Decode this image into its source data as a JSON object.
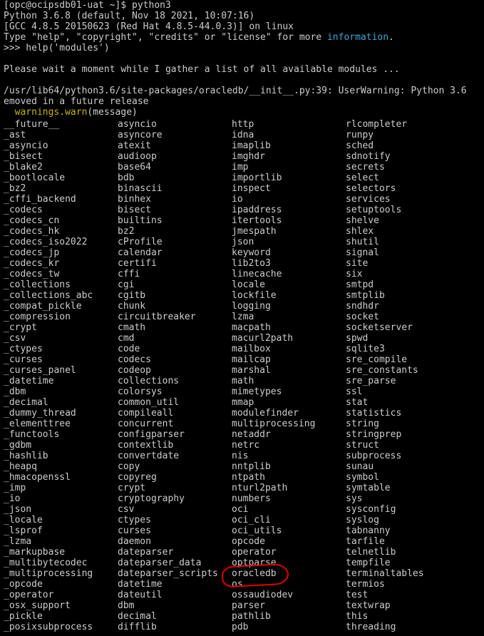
{
  "terminal": {
    "prompt_line": "[opc@ocipsdb01-uat ~]$ python3",
    "banner_1": "Python 3.6.8 (default, Nov 18 2021, 10:07:16)",
    "banner_2": "[GCC 4.8.5 20150623 (Red Hat 4.8.5-44.0.3)] on linux",
    "banner_3_prefix": "Type \"help\", \"copyright\", \"credits\" or \"license\" for more ",
    "banner_3_link": "information",
    "banner_3_suffix": ".",
    "repl_input": ">>> help('modules')",
    "blank": "",
    "wait_message": "Please wait a moment while I gather a list of all available modules ...",
    "warning_1": "/usr/lib64/python3.6/site-packages/oracledb/__init__.py:39: UserWarning: Python 3.6",
    "warning_2": "emoved in a future release",
    "warning_3_indent": "  ",
    "warning_3_fn": "warnings.warn",
    "warning_3_rest": "(message)"
  },
  "colors": {
    "background": "#000000",
    "text": "#cccccc",
    "link": "#3fa6d6",
    "warn_function": "#c8b400",
    "highlight": "#e10000"
  },
  "modules": [
    [
      "__future__",
      "asyncio",
      "http",
      "rlcompleter"
    ],
    [
      "_ast",
      "asyncore",
      "idna",
      "runpy"
    ],
    [
      "_asyncio",
      "atexit",
      "imaplib",
      "sched"
    ],
    [
      "_bisect",
      "audioop",
      "imghdr",
      "sdnotify"
    ],
    [
      "_blake2",
      "base64",
      "imp",
      "secrets"
    ],
    [
      "_bootlocale",
      "bdb",
      "importlib",
      "select"
    ],
    [
      "_bz2",
      "binascii",
      "inspect",
      "selectors"
    ],
    [
      "_cffi_backend",
      "binhex",
      "io",
      "services"
    ],
    [
      "_codecs",
      "bisect",
      "ipaddress",
      "setuptools"
    ],
    [
      "_codecs_cn",
      "builtins",
      "itertools",
      "shelve"
    ],
    [
      "_codecs_hk",
      "bz2",
      "jmespath",
      "shlex"
    ],
    [
      "_codecs_iso2022",
      "cProfile",
      "json",
      "shutil"
    ],
    [
      "_codecs_jp",
      "calendar",
      "keyword",
      "signal"
    ],
    [
      "_codecs_kr",
      "certifi",
      "lib2to3",
      "site"
    ],
    [
      "_codecs_tw",
      "cffi",
      "linecache",
      "six"
    ],
    [
      "_collections",
      "cgi",
      "locale",
      "smtpd"
    ],
    [
      "_collections_abc",
      "cgitb",
      "lockfile",
      "smtplib"
    ],
    [
      "_compat_pickle",
      "chunk",
      "logging",
      "sndhdr"
    ],
    [
      "_compression",
      "circuitbreaker",
      "lzma",
      "socket"
    ],
    [
      "_crypt",
      "cmath",
      "macpath",
      "socketserver"
    ],
    [
      "_csv",
      "cmd",
      "macurl2path",
      "spwd"
    ],
    [
      "_ctypes",
      "code",
      "mailbox",
      "sqlite3"
    ],
    [
      "_curses",
      "codecs",
      "mailcap",
      "sre_compile"
    ],
    [
      "_curses_panel",
      "codeop",
      "marshal",
      "sre_constants"
    ],
    [
      "_datetime",
      "collections",
      "math",
      "sre_parse"
    ],
    [
      "_dbm",
      "colorsys",
      "mimetypes",
      "ssl"
    ],
    [
      "_decimal",
      "common_util",
      "mmap",
      "stat"
    ],
    [
      "_dummy_thread",
      "compileall",
      "modulefinder",
      "statistics"
    ],
    [
      "_elementtree",
      "concurrent",
      "multiprocessing",
      "string"
    ],
    [
      "_functools",
      "configparser",
      "netaddr",
      "stringprep"
    ],
    [
      "_gdbm",
      "contextlib",
      "netrc",
      "struct"
    ],
    [
      "_hashlib",
      "convertdate",
      "nis",
      "subprocess"
    ],
    [
      "_heapq",
      "copy",
      "nntplib",
      "sunau"
    ],
    [
      "_hmacopenssl",
      "copyreg",
      "ntpath",
      "symbol"
    ],
    [
      "_imp",
      "crypt",
      "nturl2path",
      "symtable"
    ],
    [
      "_io",
      "cryptography",
      "numbers",
      "sys"
    ],
    [
      "_json",
      "csv",
      "oci",
      "sysconfig"
    ],
    [
      "_locale",
      "ctypes",
      "oci_cli",
      "syslog"
    ],
    [
      "_lsprof",
      "curses",
      "oci_utils",
      "tabnanny"
    ],
    [
      "_lzma",
      "daemon",
      "opcode",
      "tarfile"
    ],
    [
      "_markupbase",
      "dateparser",
      "operator",
      "telnetlib"
    ],
    [
      "_multibytecodec",
      "dateparser_data",
      "optparse",
      "tempfile"
    ],
    [
      "_multiprocessing",
      "dateparser_scripts",
      "oracledb",
      "terminaltables"
    ],
    [
      "_opcode",
      "datetime",
      "os",
      "termios"
    ],
    [
      "_operator",
      "dateutil",
      "ossaudiodev",
      "test"
    ],
    [
      "_osx_support",
      "dbm",
      "parser",
      "textwrap"
    ],
    [
      "_pickle",
      "decimal",
      "pathlib",
      "this"
    ],
    [
      "_posixsubprocess",
      "difflib",
      "pdb",
      "threading"
    ]
  ]
}
